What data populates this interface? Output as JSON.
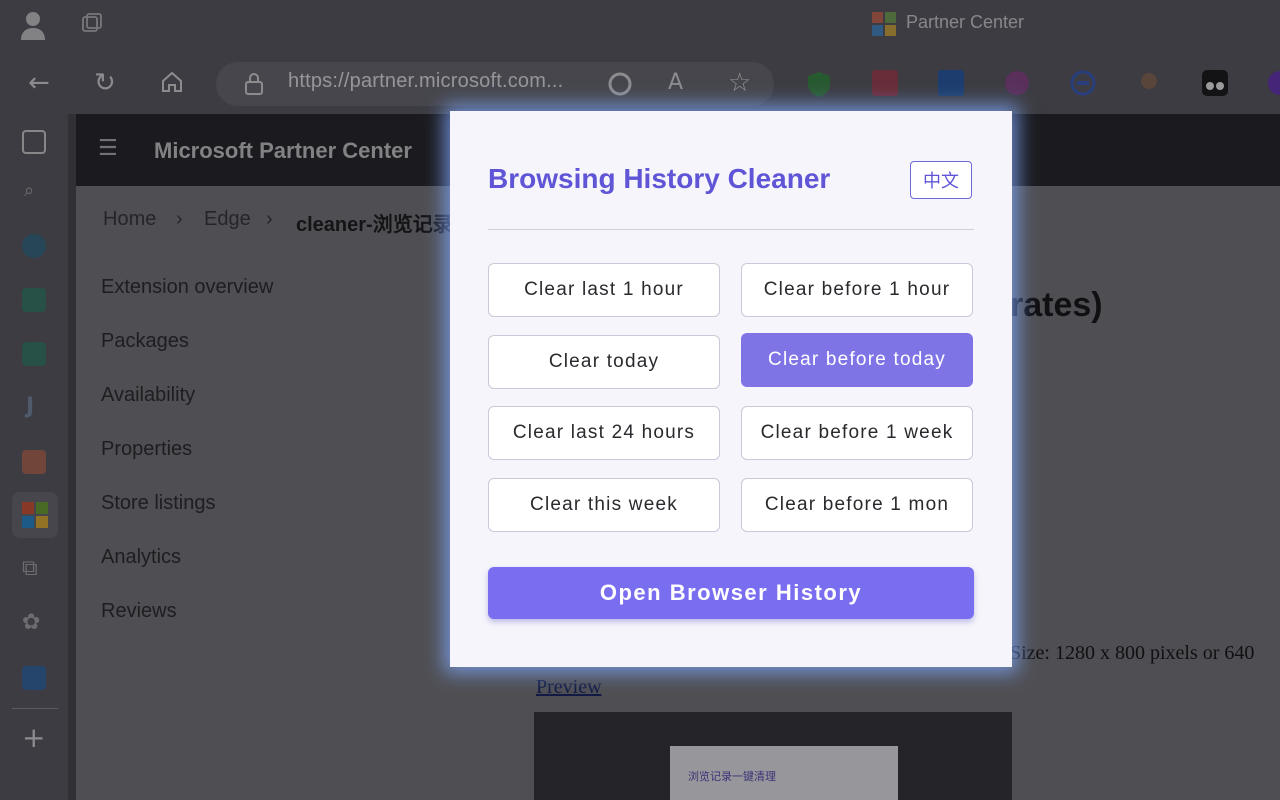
{
  "browser": {
    "tab_title": "Partner Center",
    "url": "https://partner.microsoft.com..."
  },
  "page": {
    "app_title": "Microsoft Partner Center",
    "breadcrumb": [
      "Home",
      "Edge",
      "cleaner-浏览记录"
    ],
    "nav": [
      "Extension overview",
      "Packages",
      "Availability",
      "Properties",
      "Store listings",
      "Analytics",
      "Reviews"
    ],
    "heading_fragment": "rates)",
    "size_text": "Size: 1280 x 800 pixels or 640",
    "preview_link": "Preview",
    "thumb_title": "浏览记录一键清理"
  },
  "popup": {
    "title": "Browsing History Cleaner",
    "lang_button": "中文",
    "buttons": [
      "Clear last 1 hour",
      "Clear before 1 hour",
      "Clear today",
      "Clear before today",
      "Clear last 24 hours",
      "Clear before 1 week",
      "Clear this week",
      "Clear before 1 mon"
    ],
    "active_button": "Clear before today",
    "open_button": "Open Browser History"
  },
  "colors": {
    "accent": "#7a6ef0",
    "title": "#5f55d6",
    "active_button": "#7f74e6"
  }
}
